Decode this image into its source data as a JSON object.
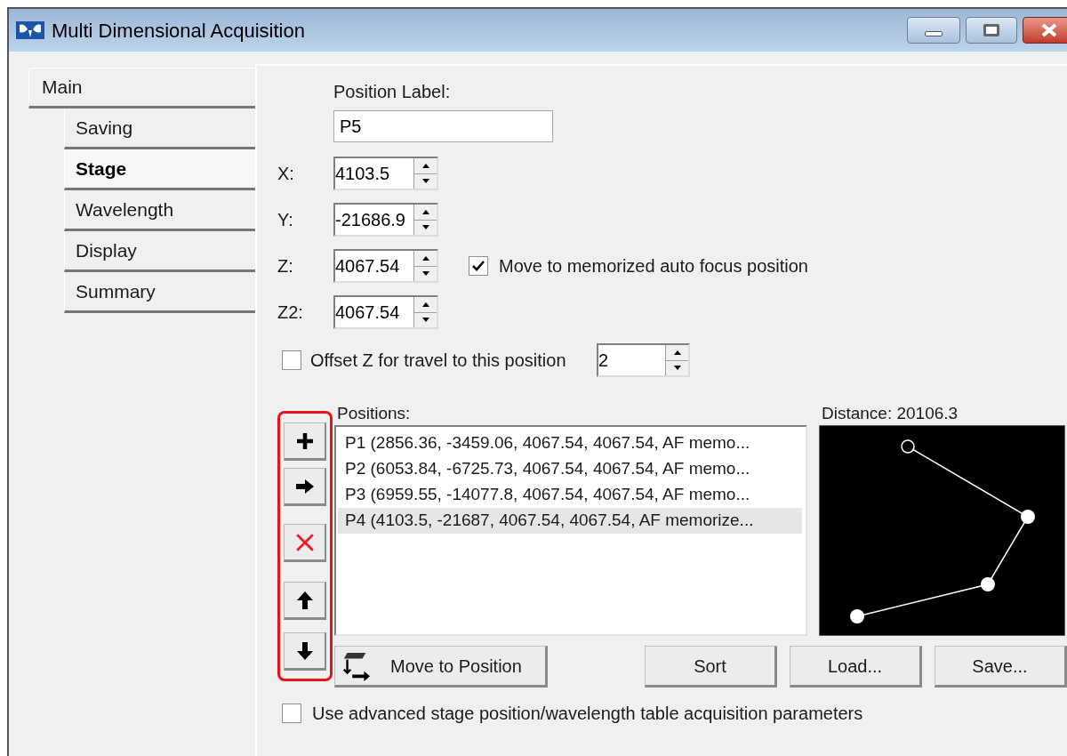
{
  "window": {
    "title": "Multi Dimensional Acquisition"
  },
  "tabs": [
    {
      "label": "Main",
      "selected": false,
      "children": [
        {
          "label": "Saving",
          "selected": false
        },
        {
          "label": "Stage",
          "selected": true
        },
        {
          "label": "Wavelength",
          "selected": false
        },
        {
          "label": "Display",
          "selected": false
        },
        {
          "label": "Summary",
          "selected": false
        }
      ]
    }
  ],
  "position_label": {
    "label": "Position Label:",
    "value": "P5"
  },
  "coordinates": [
    {
      "label": "X:",
      "value": "4103.5"
    },
    {
      "label": "Y:",
      "value": "-21686.9"
    },
    {
      "label": "Z:",
      "value": "4067.54"
    },
    {
      "label": "Z2:",
      "value": "4067.54"
    }
  ],
  "autofocus_checkbox": {
    "label": "Move to memorized auto focus position",
    "checked": true
  },
  "offset": {
    "label": "Offset Z for travel to this position",
    "checked": false,
    "value": "2"
  },
  "positions": {
    "label": "Positions:",
    "items": [
      {
        "text": "P1 (2856.36, -3459.06, 4067.54, 4067.54, AF memo...",
        "selected": false
      },
      {
        "text": "P2 (6053.84, -6725.73, 4067.54, 4067.54, AF memo...",
        "selected": false
      },
      {
        "text": "P3 (6959.55, -14077.8, 4067.54, 4067.54, AF memo...",
        "selected": false
      },
      {
        "text": "P4 (4103.5, -21687, 4067.54, 4067.54, AF memorize...",
        "selected": true
      }
    ]
  },
  "distance": "Distance: 20106.3",
  "buttons": [
    {
      "label": "Move to Position",
      "kind": "move"
    },
    {
      "label": "Sort",
      "kind": "plain"
    },
    {
      "label": "Load...",
      "kind": "plain"
    },
    {
      "label": "Save...",
      "kind": "plain"
    }
  ],
  "advanced_checkbox": {
    "label": "Use advanced stage position/wavelength table acquisition parameters",
    "checked": false
  }
}
